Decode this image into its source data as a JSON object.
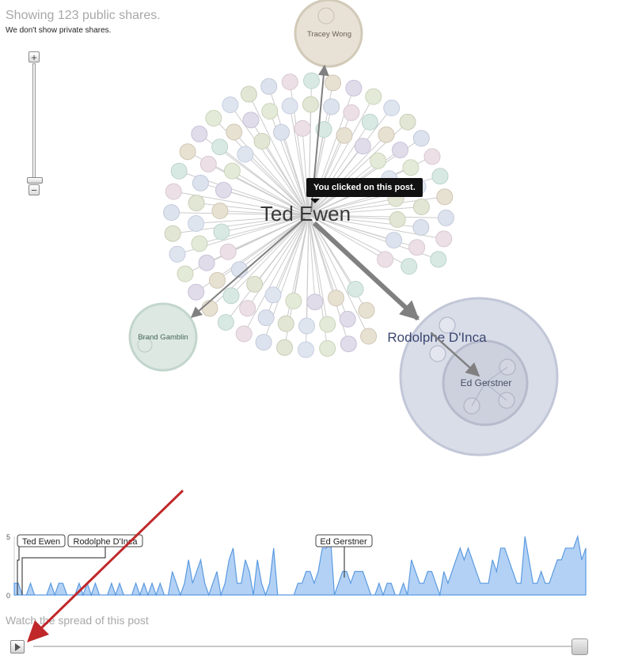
{
  "header": {
    "share_count": "Showing 123 public shares.",
    "private_note": "We don't show private shares."
  },
  "zoom": {
    "plus": "+",
    "minus": "−"
  },
  "graph": {
    "root": "Ted Ewen",
    "nodes": {
      "tracey": "Tracey Wong",
      "brand": "Brand Gamblin",
      "rodolphe": "Rodolphe D'Inca",
      "ed": "Ed Gerstner"
    },
    "tooltip": "You clicked on this post."
  },
  "chart_data": {
    "type": "area",
    "ylim": [
      0,
      5
    ],
    "yticks": [
      "5",
      "0"
    ],
    "annotations": [
      "Ted Ewen",
      "Rodolphe D'Inca",
      "Ed Gerstner"
    ],
    "values": [
      1,
      1,
      0,
      0,
      1,
      0,
      0,
      0,
      0,
      1,
      0,
      1,
      1,
      0,
      0,
      0,
      1,
      0,
      1,
      0,
      1,
      0,
      0,
      0,
      1,
      0,
      1,
      0,
      0,
      0,
      1,
      0,
      1,
      0,
      1,
      0,
      1,
      0,
      0,
      2,
      1,
      0,
      1,
      3,
      1,
      2,
      3,
      1,
      0,
      1,
      2,
      0,
      1,
      3,
      4,
      1,
      1,
      3,
      2,
      0,
      3,
      1,
      0,
      1,
      4,
      0,
      0,
      0,
      0,
      0,
      1,
      1,
      2,
      2,
      1,
      2,
      4,
      4,
      5,
      0,
      1,
      2,
      2,
      1,
      2,
      2,
      2,
      1,
      0,
      0,
      1,
      0,
      1,
      1,
      0,
      0,
      1,
      0,
      3,
      2,
      1,
      1,
      2,
      2,
      1,
      0,
      2,
      1,
      2,
      3,
      4,
      3,
      4,
      3,
      2,
      1,
      1,
      1,
      3,
      2,
      4,
      4,
      3,
      2,
      1,
      1,
      5,
      3,
      1,
      1,
      2,
      1,
      1,
      2,
      3,
      3,
      4,
      4,
      4,
      5,
      3,
      4
    ]
  },
  "playback": {
    "caption": "Watch the spread of this post"
  }
}
